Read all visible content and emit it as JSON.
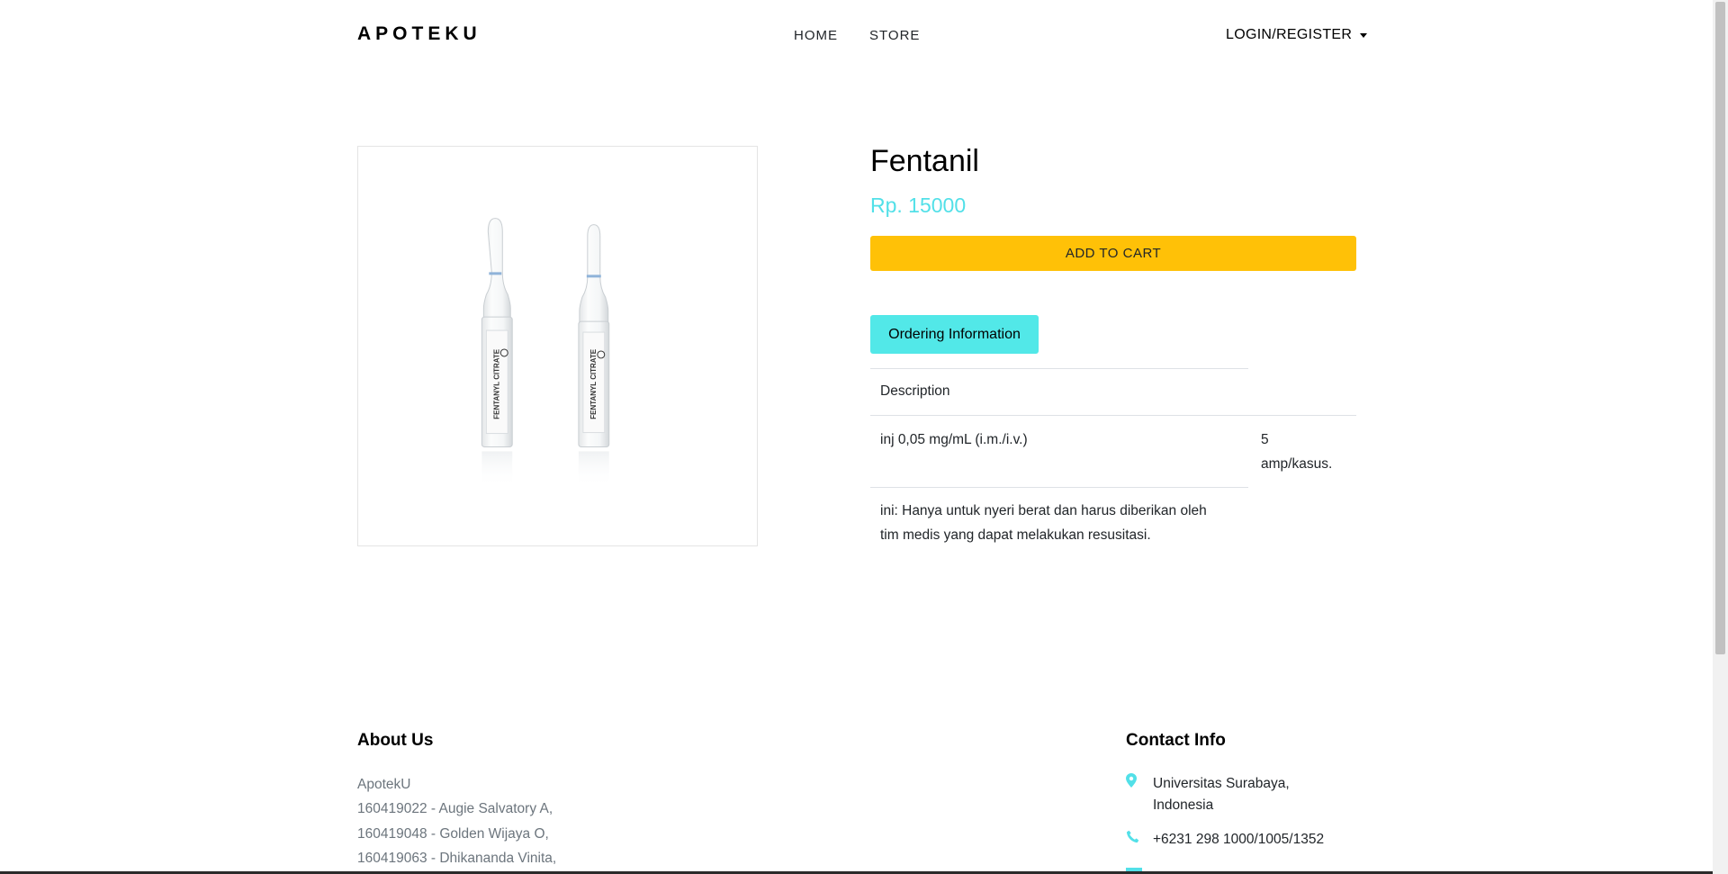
{
  "brand": "APOTEKU",
  "nav": {
    "home": "HOME",
    "store": "STORE",
    "login": "LOGIN/REGISTER"
  },
  "product": {
    "name": "Fentanil",
    "price": "Rp. 15000",
    "add_to_cart": "ADD TO CART",
    "tab_label": "Ordering Information",
    "table": {
      "header": "Description",
      "row_description": "inj 0,05 mg/mL (i.m./i.v.)",
      "row_quantity_line1": "5",
      "row_quantity_line2": "amp/kasus.",
      "note_line1": "ini: Hanya untuk nyeri berat dan harus diberikan oleh",
      "note_line2": "tim medis yang dapat melakukan resusitasi."
    },
    "image_icon": "product-photo-ampoules",
    "ampoule_labels": [
      "FENTANYL CITRATE",
      "FENTANYL CITRATE"
    ]
  },
  "footer": {
    "about_title": "About Us",
    "about_lines": [
      "ApotekU",
      "160419022 - Augie Salvatory A,",
      "160419048 - Golden Wijaya O,",
      "160419063 - Dhikananda Vinita,"
    ],
    "contact_title": "Contact Info",
    "contact_address_line1": "Universitas Surabaya,",
    "contact_address_line2": "Indonesia",
    "contact_phone": "+6231 298 1000/1005/1352",
    "contact_icons": [
      "map-marker-icon",
      "phone-icon",
      "envelope-icon"
    ]
  },
  "colors": {
    "accent": "#52e0e8",
    "button": "#ffc107",
    "tab": "#52e8e8"
  }
}
